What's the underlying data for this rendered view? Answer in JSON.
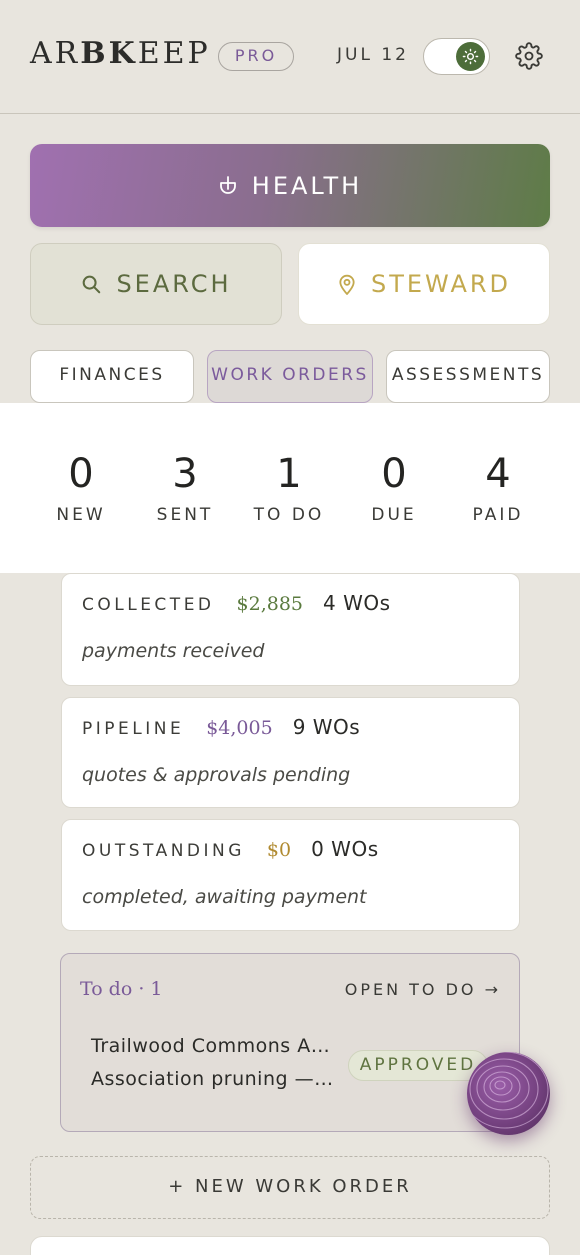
{
  "header": {
    "logo_plain_1": "AR",
    "logo_bold": "BK",
    "logo_plain_2": "EEP",
    "plan_badge": "PRO",
    "date": "JUL 12",
    "theme_toggle_state": "on"
  },
  "health": {
    "label": "HEALTH"
  },
  "actions": {
    "search_label": "SEARCH",
    "steward_label": "STEWARD"
  },
  "tabs": [
    {
      "label": "FINANCES"
    },
    {
      "label": "WORK ORDERS"
    },
    {
      "label": "ASSESSMENTS"
    }
  ],
  "active_tab": "WORK ORDERS",
  "stats": [
    {
      "value": "0",
      "label": "NEW"
    },
    {
      "value": "3",
      "label": "SENT"
    },
    {
      "value": "1",
      "label": "TO DO"
    },
    {
      "value": "0",
      "label": "DUE"
    },
    {
      "value": "4",
      "label": "PAID"
    }
  ],
  "finance_cards": [
    {
      "title": "COLLECTED",
      "amount": "$2,885",
      "wos": "4 WOs",
      "subtitle": "payments received"
    },
    {
      "title": "PIPELINE",
      "amount": "$4,005",
      "wos": "9 WOs",
      "subtitle": "quotes & approvals pending"
    },
    {
      "title": "OUTSTANDING",
      "amount": "$0",
      "wos": "0 WOs",
      "subtitle": "completed, awaiting payment"
    }
  ],
  "todo": {
    "title": "To do · 1",
    "link": "OPEN TO DO →",
    "item_line1": "Trailwood Commons A…",
    "item_line2": "Association pruning —…",
    "status": "APPROVED"
  },
  "new_work_order": "+ NEW WORK ORDER",
  "colors": {
    "background": "#e8e5de",
    "accent_purple": "#7a5a98",
    "accent_green": "#5e7c47",
    "accent_gold": "#c3a94e",
    "amount_collected": "#5a7a3e",
    "amount_pipeline": "#7a5a98",
    "amount_outstanding": "#b08a30"
  }
}
